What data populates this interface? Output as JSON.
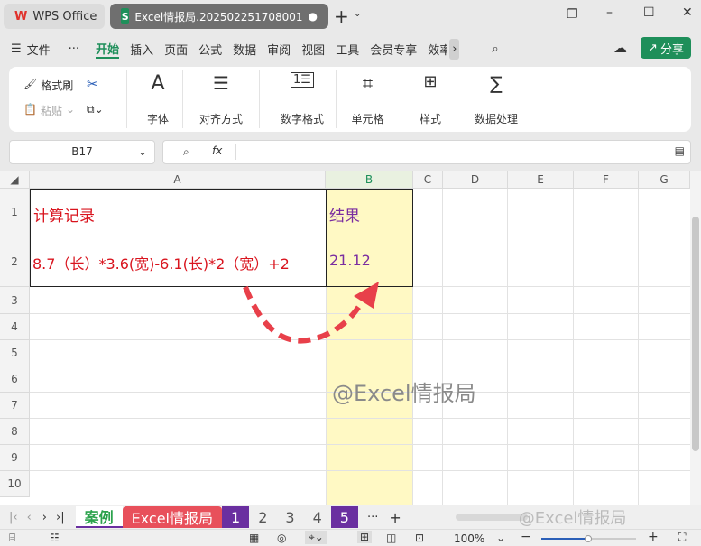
{
  "titlebar": {
    "app_tab": "WPS Office",
    "doc_tab": "Excel情报局.202502251708001",
    "new_tab": "+"
  },
  "menu": {
    "file": "文件",
    "more": "···",
    "items": [
      "开始",
      "插入",
      "页面",
      "公式",
      "数据",
      "审阅",
      "视图",
      "工具",
      "会员专享",
      "效率"
    ],
    "active": "开始",
    "share": "分享"
  },
  "ribbon": {
    "format_painter": "格式刷",
    "paste": "粘贴",
    "font": "字体",
    "align": "对齐方式",
    "number_format": "数字格式",
    "cell": "单元格",
    "style": "样式",
    "data_process": "数据处理"
  },
  "formula_bar": {
    "name_box": "B17",
    "fx": "fx",
    "value": ""
  },
  "columns": [
    "A",
    "B",
    "C",
    "D",
    "E",
    "F",
    "G"
  ],
  "rows": [
    "1",
    "2",
    "3",
    "4",
    "5",
    "6",
    "7",
    "8",
    "9",
    "10"
  ],
  "cells": {
    "A1": "计算记录",
    "B1": "结果",
    "A2": "8.7（长）*3.6(宽)-6.1(长)*2（宽）+2",
    "B2": "21.12"
  },
  "watermark": "@Excel情报局",
  "sheets": [
    {
      "name": "案例",
      "color": "#ffffff"
    },
    {
      "name": "Excel情报局",
      "color": "#e8505b"
    },
    {
      "name": "1",
      "color": "#6a2fa0"
    },
    {
      "name": "2",
      "color": ""
    },
    {
      "name": "3",
      "color": ""
    },
    {
      "name": "4",
      "color": ""
    },
    {
      "name": "5",
      "color": "#6a2fa0"
    }
  ],
  "sheet_more": "···",
  "add_sheet": "+",
  "status": {
    "zoom": "100%",
    "zoom_level": 0.5
  },
  "colors": {
    "text_red": "#d9141e",
    "text_purple": "#7a2da0",
    "highlight": "#fff9c4",
    "accent": "#1e8f5a"
  }
}
